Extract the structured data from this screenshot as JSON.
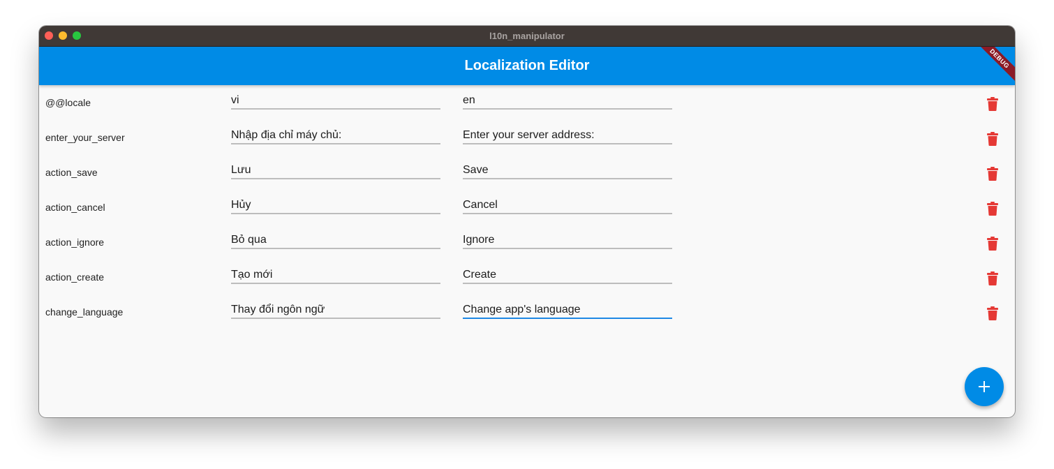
{
  "window": {
    "title": "l10n_manipulator"
  },
  "appbar": {
    "title": "Localization Editor",
    "debug_banner": "DEBUG"
  },
  "entries": [
    {
      "key": "@@locale",
      "vi": "vi",
      "en": "en"
    },
    {
      "key": "enter_your_server",
      "vi": "Nhập địa chỉ máy chủ:",
      "en": "Enter your server address:"
    },
    {
      "key": "action_save",
      "vi": "Lưu",
      "en": "Save"
    },
    {
      "key": "action_cancel",
      "vi": "Hủy",
      "en": "Cancel"
    },
    {
      "key": "action_ignore",
      "vi": "Bỏ qua",
      "en": "Ignore"
    },
    {
      "key": "action_create",
      "vi": "Tạo mới",
      "en": "Create"
    },
    {
      "key": "change_language",
      "vi": "Thay đổi ngôn ngữ",
      "en": "Change app's language"
    }
  ],
  "focused_entry": 6,
  "focused_column": "en",
  "icons": {
    "delete": "trash-icon",
    "add": "plus-icon"
  },
  "colors": {
    "accent": "#008be6",
    "delete": "#e53935",
    "focus_underline": "#1e88e5"
  }
}
